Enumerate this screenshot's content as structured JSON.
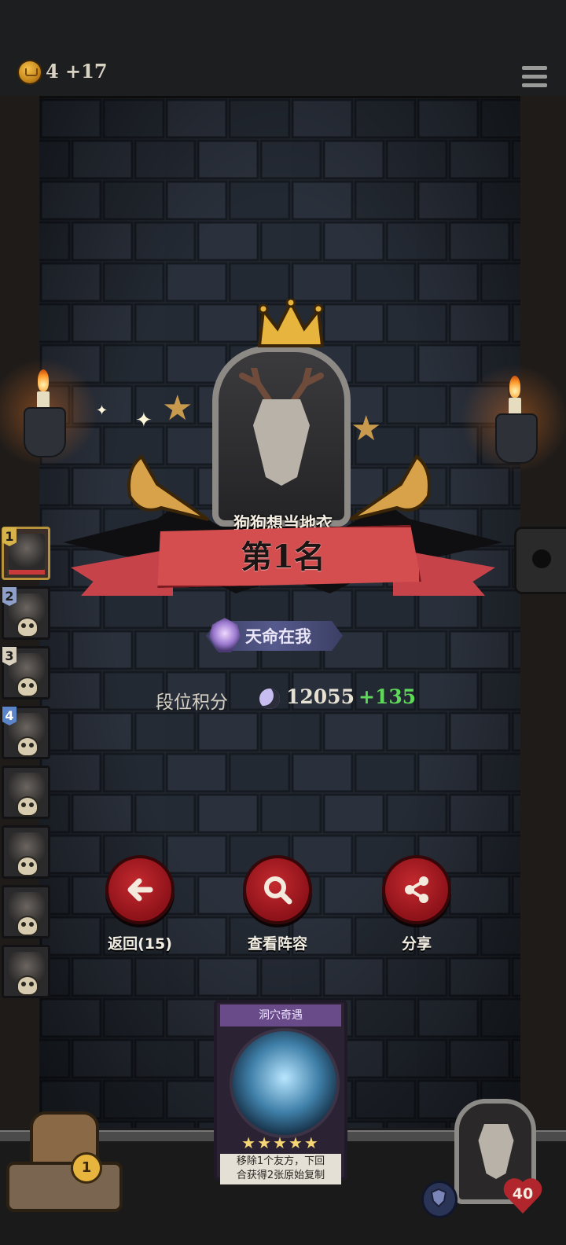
{
  "top": {
    "coins_text": "4 +17"
  },
  "player": {
    "name": "狗狗想当地衣",
    "rank_title": "第1名",
    "badge_text": "天命在我",
    "score_label": "段位积分",
    "score_value": "12055",
    "score_delta": "+135"
  },
  "rank_list": [
    {
      "num": "1",
      "color": "#d6b24a",
      "eliminated": false
    },
    {
      "num": "2",
      "color": "#8ea0c8",
      "eliminated": true
    },
    {
      "num": "3",
      "color": "#d9d0bd",
      "eliminated": true
    },
    {
      "num": "4",
      "color": "#5b84c9",
      "eliminated": true
    },
    {
      "num": "",
      "color": "",
      "eliminated": true
    },
    {
      "num": "",
      "color": "",
      "eliminated": true
    },
    {
      "num": "",
      "color": "",
      "eliminated": true
    },
    {
      "num": "",
      "color": "",
      "eliminated": true
    }
  ],
  "actions": {
    "back_label": "返回(15)",
    "lineup_label": "查看阵容",
    "share_label": "分享"
  },
  "card": {
    "title": "洞穴奇遇",
    "stars": "★★★★★",
    "desc_line1": "移除1个友方，下回",
    "desc_line2": "合获得2张原始复制"
  },
  "bottom": {
    "trap_coin": "1",
    "hp": "40"
  },
  "colors": {
    "accent_red": "#c42a2f",
    "ribbon": "#d44d4f",
    "delta_green": "#5ed95a"
  }
}
